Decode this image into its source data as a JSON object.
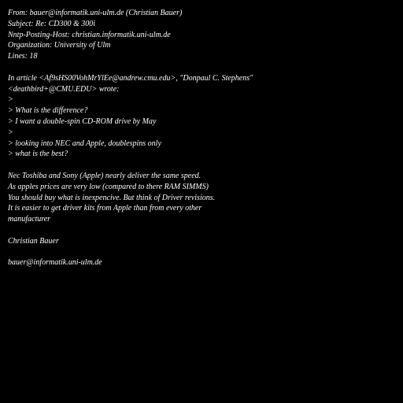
{
  "background_color": "#000000",
  "text_color": "#ffffff",
  "lines": [
    "From: bauer@informatik.uni-ulm.de (Christian Bauer)",
    "Subject: Re: CD300 & 300i",
    "Nntp-Posting-Host: christian.informatik.uni-ulm.de",
    "Organization: University of Ulm",
    "Lines: 18",
    "",
    "In article <Af9sHS00VohMrYlEe@andrew.cmu.edu>, \"Donpaul C. Stephens\"",
    "<deathbird+@CMU.EDU> wrote:",
    ">",
    "> What is the difference?",
    "> I want a double-spin CD-ROM drive by May",
    ">",
    "> looking into NEC and Apple, doublespins only",
    "> what is the best?",
    "",
    "Nec Toshiba and Sony (Apple) nearly deliver the same speed.",
    "As apples prices are very low (compared to there RAM SIMMS)",
    "You should buy what is inexpencive. But think of Driver revisions.",
    "It is easier to get driver kits from Apple than from every other",
    "manufacturer",
    "",
    "Christian Bauer",
    "",
    "bauer@informatik.uni-ulm.de"
  ]
}
